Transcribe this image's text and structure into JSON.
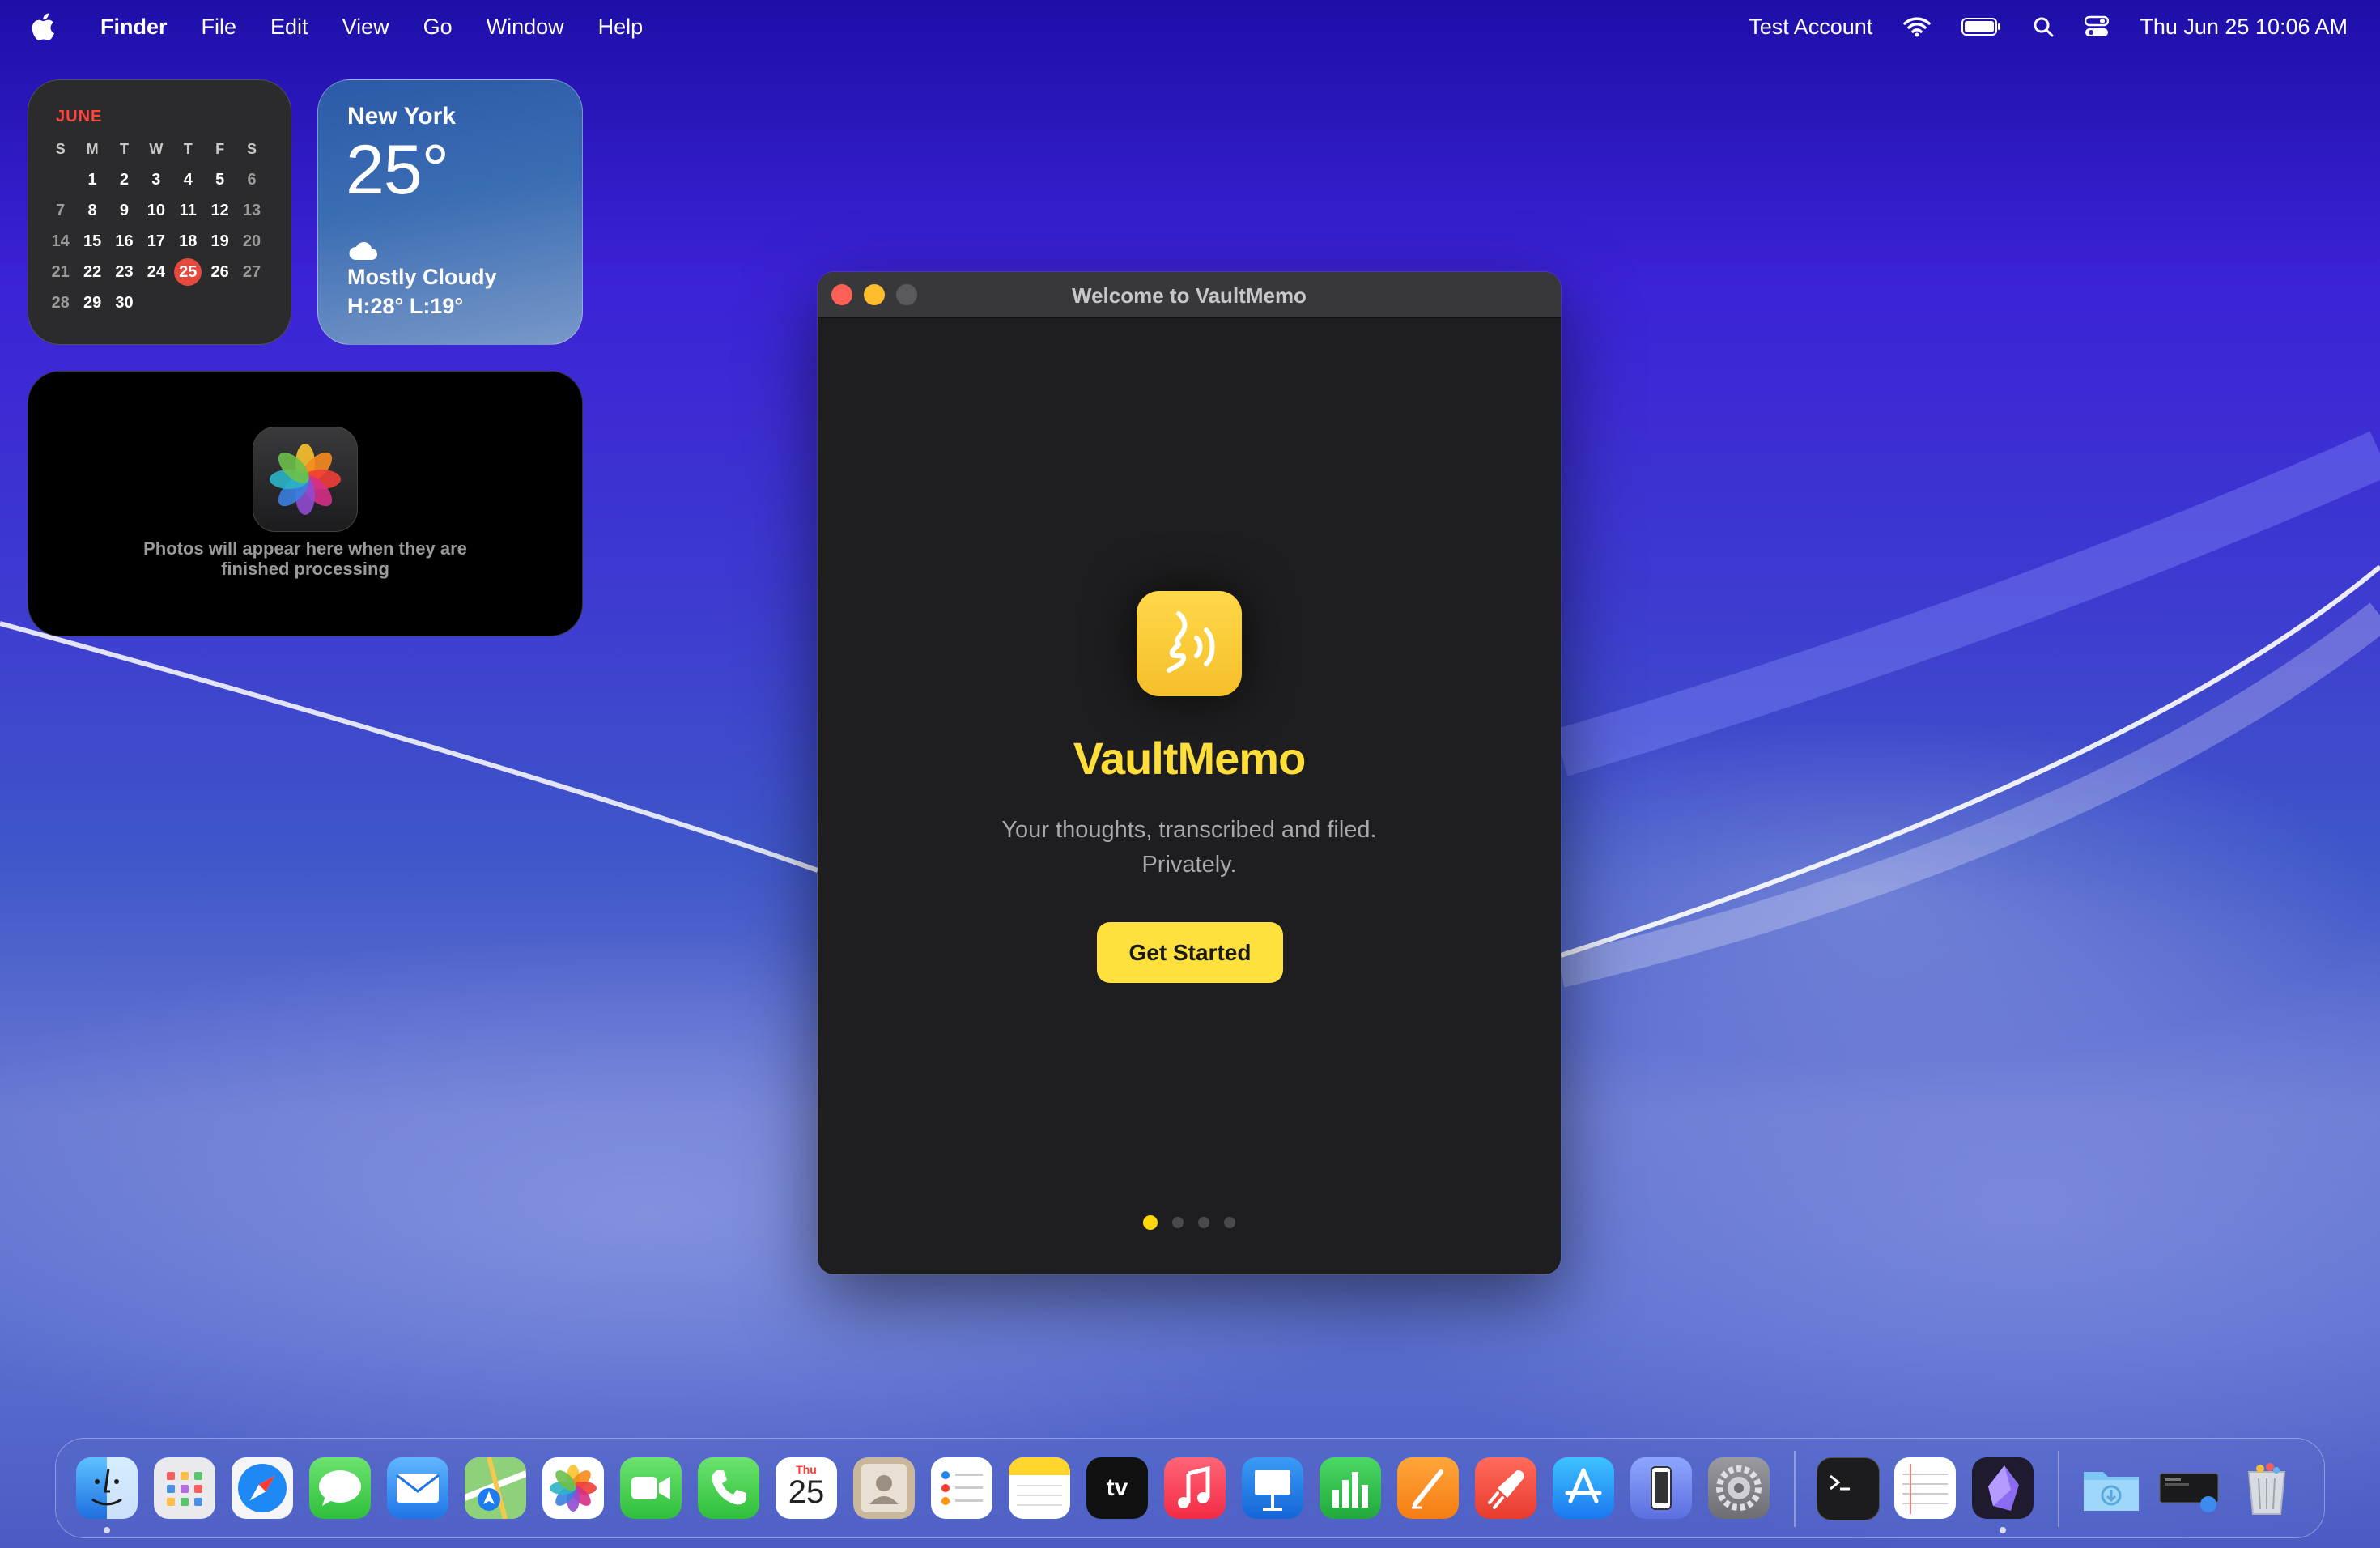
{
  "menubar": {
    "app_name": "Finder",
    "menus": [
      "File",
      "Edit",
      "View",
      "Go",
      "Window",
      "Help"
    ],
    "account": "Test Account",
    "datetime": "Thu Jun 25  10:06 AM"
  },
  "widgets": {
    "calendar": {
      "month": "JUNE",
      "weekdays": [
        "S",
        "M",
        "T",
        "W",
        "T",
        "F",
        "S"
      ],
      "days": [
        [
          "",
          "1",
          "2",
          "3",
          "4",
          "5",
          "6"
        ],
        [
          "7",
          "8",
          "9",
          "10",
          "11",
          "12",
          "13"
        ],
        [
          "14",
          "15",
          "16",
          "17",
          "18",
          "19",
          "20"
        ],
        [
          "21",
          "22",
          "23",
          "24",
          "25",
          "26",
          "27"
        ],
        [
          "28",
          "29",
          "30",
          "",
          "",
          "",
          ""
        ]
      ],
      "today": "25"
    },
    "weather": {
      "city": "New York",
      "temp": "25°",
      "condition": "Mostly Cloudy",
      "hilo": "H:28° L:19°"
    },
    "photos": {
      "message_line1": "Photos will appear here when they are",
      "message_line2": "finished processing"
    }
  },
  "window": {
    "title": "Welcome to VaultMemo",
    "app_name": "VaultMemo",
    "tagline_line1": "Your thoughts, transcribed and filed.",
    "tagline_line2": "Privately.",
    "primary_button": "Get Started",
    "page_count": 4,
    "current_page": 1,
    "accent_color": "#ffde3a"
  },
  "dock": {
    "apps": [
      "finder",
      "launchpad",
      "safari",
      "messages",
      "mail",
      "maps",
      "photos",
      "facetime",
      "phone",
      "calendar",
      "contacts",
      "reminders",
      "notes",
      "apple-tv",
      "music",
      "keynote",
      "numbers",
      "pages",
      "rocket",
      "app-store",
      "simulator",
      "system-settings",
      "terminal",
      "textedit",
      "obsidian",
      "downloads",
      "screen-thumbnail",
      "trash"
    ],
    "calendar_icon_day": "Thu",
    "calendar_icon_date": "25",
    "tv_label": "tv"
  }
}
